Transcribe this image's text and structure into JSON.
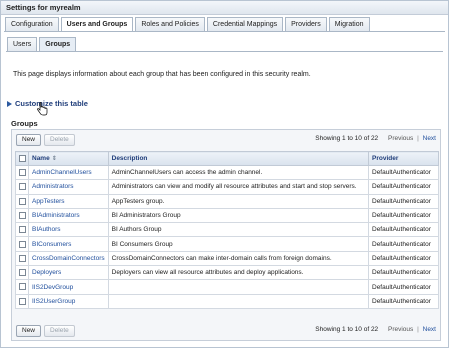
{
  "window": {
    "title": "Settings for myrealm"
  },
  "tabs": [
    {
      "label": "Configuration",
      "active": false
    },
    {
      "label": "Users and Groups",
      "active": true
    },
    {
      "label": "Roles and Policies",
      "active": false
    },
    {
      "label": "Credential Mappings",
      "active": false
    },
    {
      "label": "Providers",
      "active": false
    },
    {
      "label": "Migration",
      "active": false
    }
  ],
  "subtabs": [
    {
      "label": "Users",
      "active": false
    },
    {
      "label": "Groups",
      "active": true
    }
  ],
  "intro_text": "This page displays information about each group that has been configured in this security realm.",
  "customize_label": "Customize this table",
  "section_title": "Groups",
  "toolbar": {
    "new_label": "New",
    "delete_label": "Delete",
    "showing": "Showing 1 to 10 of 22",
    "previous": "Previous",
    "separator": "|",
    "next": "Next"
  },
  "table": {
    "columns": [
      "Name",
      "Description",
      "Provider"
    ],
    "sort_icon": "sort-ascending-icon",
    "rows": [
      {
        "name": "AdminChannelUsers",
        "description": "AdminChannelUsers can access the admin channel.",
        "provider": "DefaultAuthenticator"
      },
      {
        "name": "Administrators",
        "description": "Administrators can view and modify all resource attributes and start and stop servers.",
        "provider": "DefaultAuthenticator"
      },
      {
        "name": "AppTesters",
        "description": "AppTesters group.",
        "provider": "DefaultAuthenticator"
      },
      {
        "name": "BIAdministrators",
        "description": "BI Administrators Group",
        "provider": "DefaultAuthenticator"
      },
      {
        "name": "BIAuthors",
        "description": "BI Authors Group",
        "provider": "DefaultAuthenticator"
      },
      {
        "name": "BIConsumers",
        "description": "BI Consumers Group",
        "provider": "DefaultAuthenticator"
      },
      {
        "name": "CrossDomainConnectors",
        "description": "CrossDomainConnectors can make inter-domain calls from foreign domains.",
        "provider": "DefaultAuthenticator"
      },
      {
        "name": "Deployers",
        "description": "Deployers can view all resource attributes and deploy applications.",
        "provider": "DefaultAuthenticator"
      },
      {
        "name": "IIS2DevGroup",
        "description": "",
        "provider": "DefaultAuthenticator"
      },
      {
        "name": "IIS2UserGroup",
        "description": "",
        "provider": "DefaultAuthenticator"
      }
    ]
  },
  "colors": {
    "link": "#1f4e9c",
    "header_text": "#1f3d7a",
    "accent": "#2c5aa0"
  }
}
